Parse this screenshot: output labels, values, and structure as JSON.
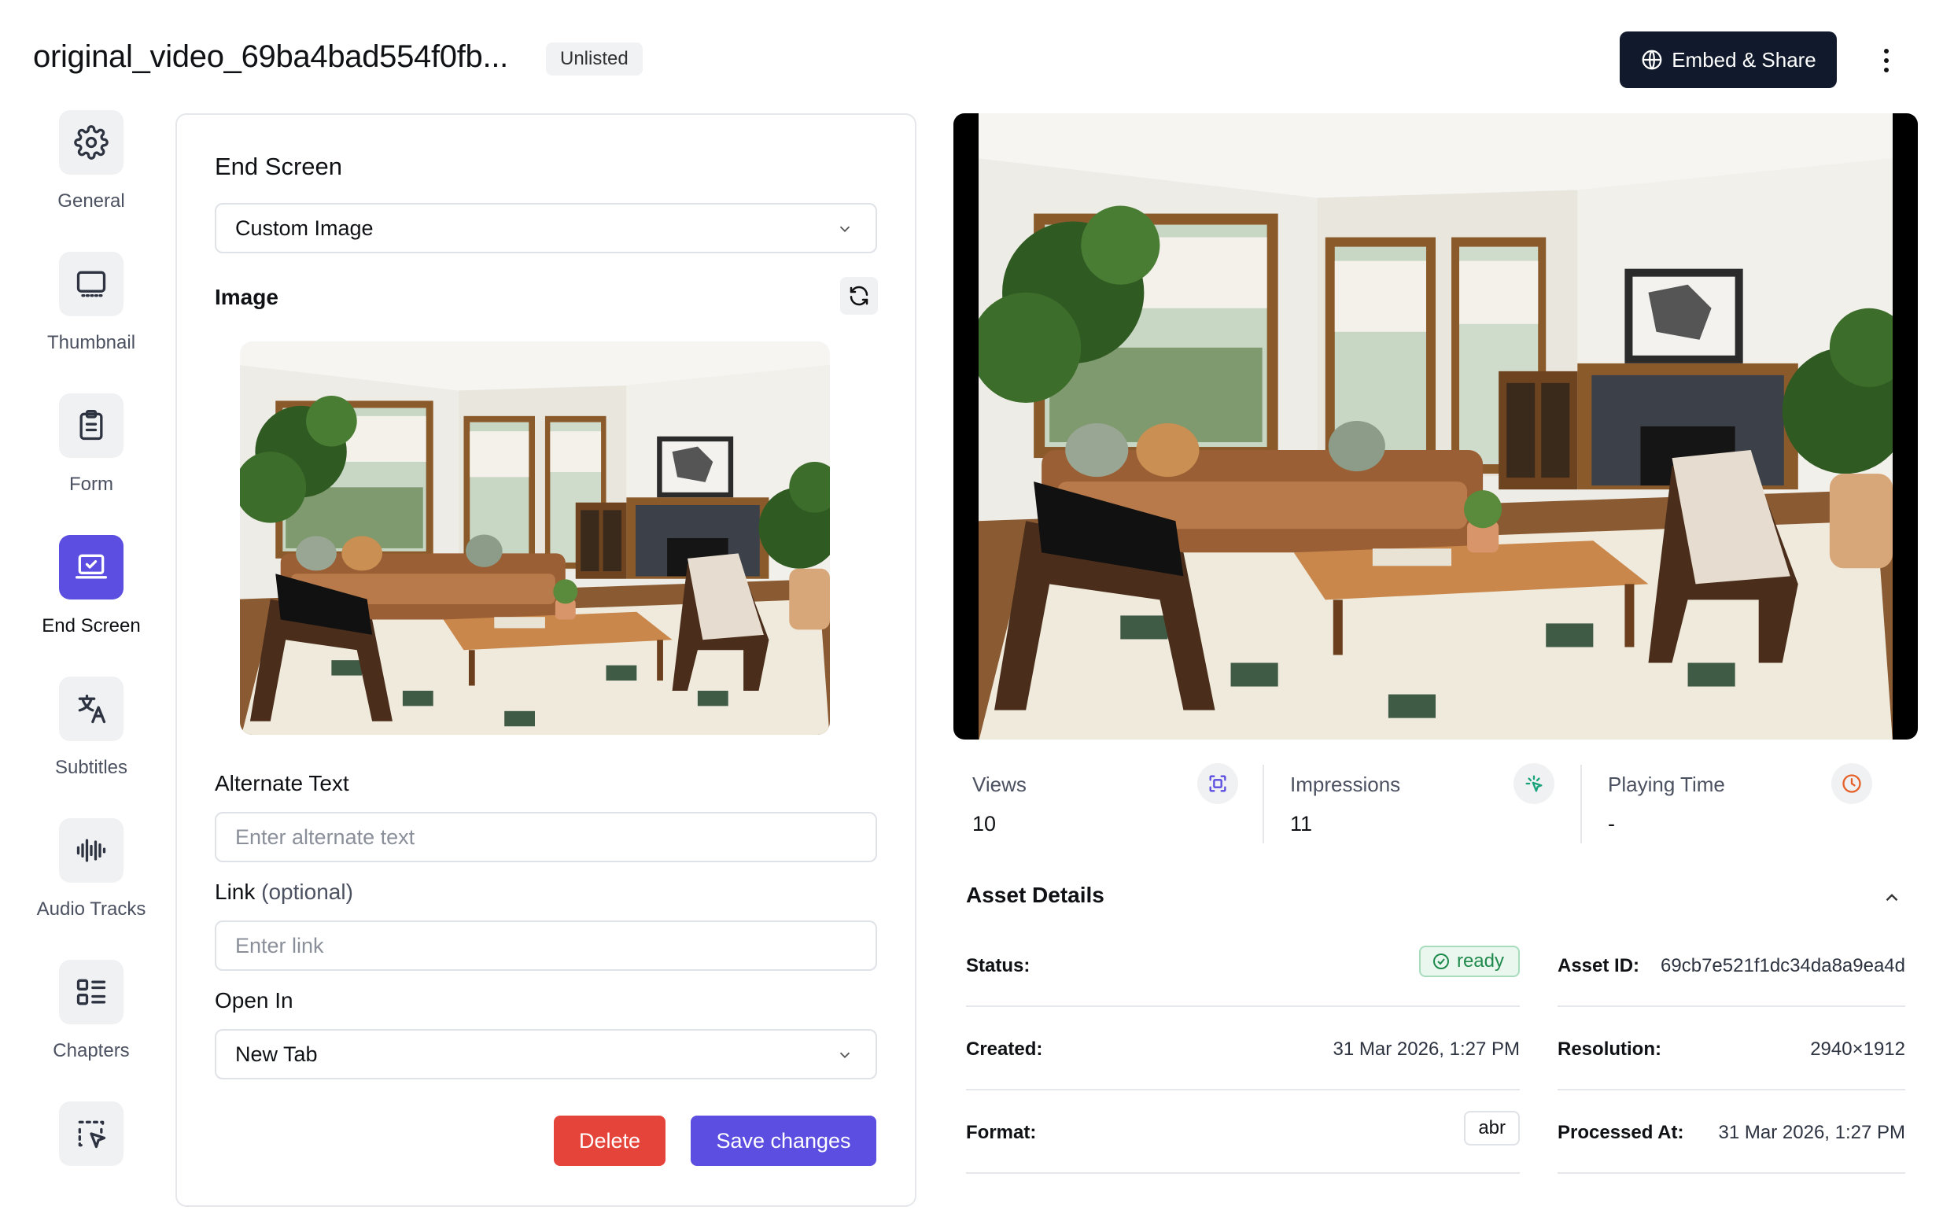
{
  "header": {
    "title": "original_video_69ba4bad554f0fb...",
    "visibility_badge": "Unlisted",
    "embed_share_label": "Embed & Share",
    "embed_icon": "globe-icon",
    "more_icon": "more-vertical-icon"
  },
  "nav": {
    "items": [
      {
        "label": "General",
        "icon": "gear-icon"
      },
      {
        "label": "Thumbnail",
        "icon": "monitor-icon"
      },
      {
        "label": "Form",
        "icon": "clipboard-icon"
      },
      {
        "label": "End Screen",
        "icon": "laptop-check-icon",
        "active": true
      },
      {
        "label": "Subtitles",
        "icon": "translate-icon"
      },
      {
        "label": "Audio Tracks",
        "icon": "audio-waveform-icon"
      },
      {
        "label": "Chapters",
        "icon": "chapters-list-icon"
      },
      {
        "label": "",
        "icon": "pointer-select-icon"
      }
    ]
  },
  "end_screen": {
    "title": "End Screen",
    "type_selected": "Custom Image",
    "image_label": "Image",
    "alt_text_label": "Alternate Text",
    "alt_text_placeholder": "Enter alternate text",
    "alt_text_value": "",
    "link_label": "Link",
    "link_optional": "(optional)",
    "link_placeholder": "Enter link",
    "link_value": "",
    "open_in_label": "Open In",
    "open_in_selected": "New Tab",
    "delete_label": "Delete",
    "save_label": "Save changes"
  },
  "stats": {
    "views_label": "Views",
    "views_value": "10",
    "impressions_label": "Impressions",
    "impressions_value": "11",
    "playing_time_label": "Playing Time",
    "playing_time_value": "-"
  },
  "asset_details": {
    "title": "Asset Details",
    "status_label": "Status:",
    "status_value": "ready",
    "asset_id_label": "Asset ID:",
    "asset_id_value": "69cb7e521f1dc34da8a9ea4d",
    "created_label": "Created:",
    "created_value": "31 Mar 2026, 1:27 PM",
    "resolution_label": "Resolution:",
    "resolution_value": "2940×1912",
    "format_label": "Format:",
    "format_value": "abr",
    "processed_label": "Processed At:",
    "processed_value": "31 Mar 2026, 1:27 PM"
  },
  "colors": {
    "accent": "#5b4ee0",
    "primary_dark": "#111a2c",
    "danger": "#e5443b",
    "success": "#1f8a4c",
    "views_icon": "#5b4ee0",
    "impressions_icon": "#1aa37a",
    "playing_time_icon": "#e5622a"
  }
}
